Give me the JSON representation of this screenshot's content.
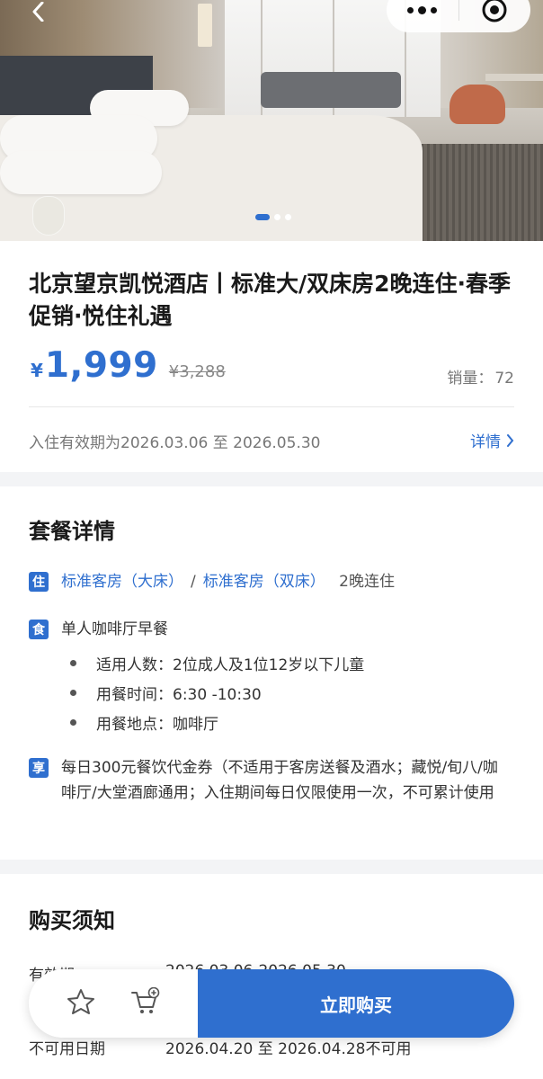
{
  "hero": {
    "slide_count": 3,
    "active_slide": 1
  },
  "product": {
    "title": "北京望京凯悦酒店丨标准大/双床房2晚连住·春季促销·悦住礼遇",
    "currency": "¥",
    "price": "1,999",
    "original_price": "¥3,288",
    "sales_label": "销量：",
    "sales_count": "72",
    "validity": "入住有效期为2026.03.06 至 2026.05.30",
    "detail_link": "详情"
  },
  "package": {
    "title": "套餐详情",
    "stay": {
      "tag": "住",
      "room1": "标准客房（大床）",
      "separator": "/",
      "room2": "标准客房（双床）",
      "nights": "2晚连住"
    },
    "meal": {
      "tag": "食",
      "name": "单人咖啡厅早餐",
      "details": [
        "适用人数：2位成人及1位12岁以下儿童",
        "用餐时间：6:30 -10:30",
        "用餐地点：咖啡厅"
      ]
    },
    "perk": {
      "tag": "享",
      "text": "每日300元餐饮代金券（不适用于客房送餐及酒水；藏悦/旬八/咖啡厅/大堂酒廊通用；入住期间每日仅限使用一次，不可累计使用"
    }
  },
  "notes": {
    "title": "购买须知",
    "rows": [
      {
        "key": "有效期",
        "value": "2026.03.06-2026.05.30"
      },
      {
        "key": "不可用日期",
        "value": "2026.04.20 至 2026.04.28不可用"
      }
    ]
  },
  "bottom_bar": {
    "buy_label": "立即购买"
  },
  "colors": {
    "accent": "#2f6fcf"
  }
}
